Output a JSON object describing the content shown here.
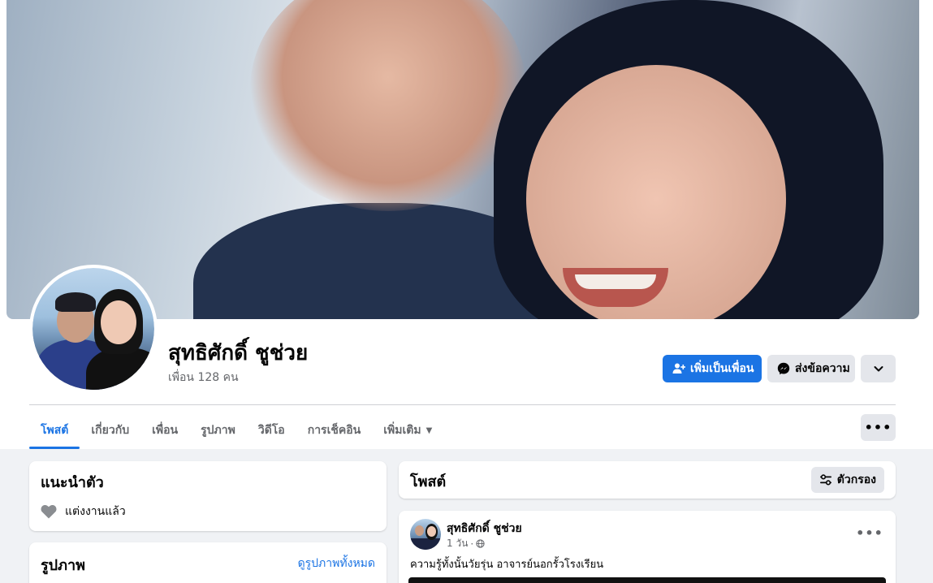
{
  "profile": {
    "name": "สุทธิศักดิ์ ชูช่วย",
    "friends": "เพื่อน 128 คน"
  },
  "actions": {
    "add_friend": "เพิ่มเป็นเพื่อน",
    "message": "ส่งข้อความ"
  },
  "tabs": [
    {
      "label": "โพสต์",
      "active": true
    },
    {
      "label": "เกี่ยวกับ"
    },
    {
      "label": "เพื่อน"
    },
    {
      "label": "รูปภาพ"
    },
    {
      "label": "วิดีโอ"
    },
    {
      "label": "การเช็คอิน"
    },
    {
      "label": "เพิ่มเติม"
    }
  ],
  "intro": {
    "title": "แนะนำตัว",
    "relationship": "แต่งงานแล้ว"
  },
  "photos": {
    "title": "รูปภาพ",
    "see_all": "ดูรูปภาพทั้งหมด"
  },
  "posts": {
    "title": "โพสต์",
    "filter": "ตัวกรอง"
  },
  "post": {
    "author": "สุทธิศักดิ์ ชูช่วย",
    "time": "1 วัน",
    "separator": "·",
    "text": "ความรู้ทั้งนั้นวัยรุ่น อาจารย์นอกรั้วโรงเรียน"
  },
  "colors": {
    "accent": "#1b74e4",
    "background": "#f0f2f5",
    "button_gray": "#e4e6eb",
    "secondary_text": "#65676b"
  }
}
